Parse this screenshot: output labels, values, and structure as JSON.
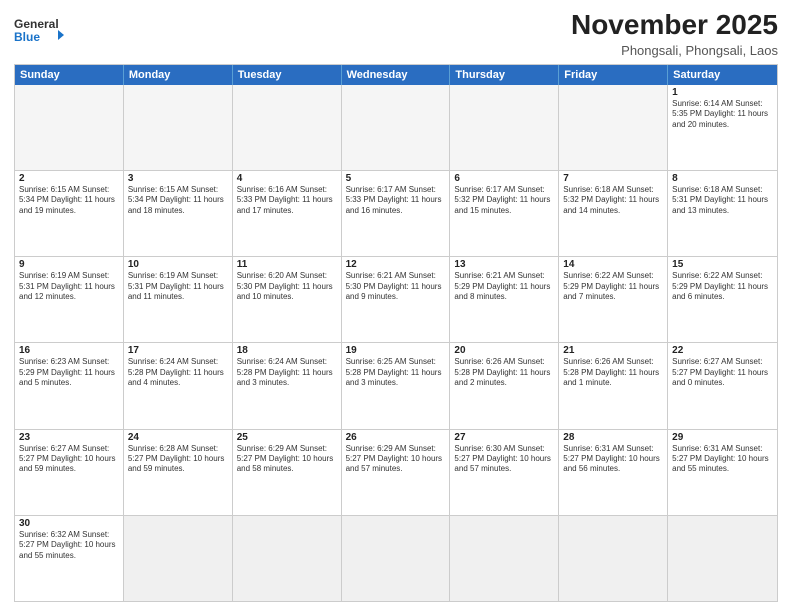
{
  "header": {
    "logo_general": "General",
    "logo_blue": "Blue",
    "month_title": "November 2025",
    "location": "Phongsali, Phongsali, Laos"
  },
  "weekdays": [
    "Sunday",
    "Monday",
    "Tuesday",
    "Wednesday",
    "Thursday",
    "Friday",
    "Saturday"
  ],
  "weeks": [
    [
      {
        "day": "",
        "info": ""
      },
      {
        "day": "",
        "info": ""
      },
      {
        "day": "",
        "info": ""
      },
      {
        "day": "",
        "info": ""
      },
      {
        "day": "",
        "info": ""
      },
      {
        "day": "",
        "info": ""
      },
      {
        "day": "1",
        "info": "Sunrise: 6:14 AM\nSunset: 5:35 PM\nDaylight: 11 hours and 20 minutes."
      }
    ],
    [
      {
        "day": "2",
        "info": "Sunrise: 6:15 AM\nSunset: 5:34 PM\nDaylight: 11 hours and 19 minutes."
      },
      {
        "day": "3",
        "info": "Sunrise: 6:15 AM\nSunset: 5:34 PM\nDaylight: 11 hours and 18 minutes."
      },
      {
        "day": "4",
        "info": "Sunrise: 6:16 AM\nSunset: 5:33 PM\nDaylight: 11 hours and 17 minutes."
      },
      {
        "day": "5",
        "info": "Sunrise: 6:17 AM\nSunset: 5:33 PM\nDaylight: 11 hours and 16 minutes."
      },
      {
        "day": "6",
        "info": "Sunrise: 6:17 AM\nSunset: 5:32 PM\nDaylight: 11 hours and 15 minutes."
      },
      {
        "day": "7",
        "info": "Sunrise: 6:18 AM\nSunset: 5:32 PM\nDaylight: 11 hours and 14 minutes."
      },
      {
        "day": "8",
        "info": "Sunrise: 6:18 AM\nSunset: 5:31 PM\nDaylight: 11 hours and 13 minutes."
      }
    ],
    [
      {
        "day": "9",
        "info": "Sunrise: 6:19 AM\nSunset: 5:31 PM\nDaylight: 11 hours and 12 minutes."
      },
      {
        "day": "10",
        "info": "Sunrise: 6:19 AM\nSunset: 5:31 PM\nDaylight: 11 hours and 11 minutes."
      },
      {
        "day": "11",
        "info": "Sunrise: 6:20 AM\nSunset: 5:30 PM\nDaylight: 11 hours and 10 minutes."
      },
      {
        "day": "12",
        "info": "Sunrise: 6:21 AM\nSunset: 5:30 PM\nDaylight: 11 hours and 9 minutes."
      },
      {
        "day": "13",
        "info": "Sunrise: 6:21 AM\nSunset: 5:29 PM\nDaylight: 11 hours and 8 minutes."
      },
      {
        "day": "14",
        "info": "Sunrise: 6:22 AM\nSunset: 5:29 PM\nDaylight: 11 hours and 7 minutes."
      },
      {
        "day": "15",
        "info": "Sunrise: 6:22 AM\nSunset: 5:29 PM\nDaylight: 11 hours and 6 minutes."
      }
    ],
    [
      {
        "day": "16",
        "info": "Sunrise: 6:23 AM\nSunset: 5:29 PM\nDaylight: 11 hours and 5 minutes."
      },
      {
        "day": "17",
        "info": "Sunrise: 6:24 AM\nSunset: 5:28 PM\nDaylight: 11 hours and 4 minutes."
      },
      {
        "day": "18",
        "info": "Sunrise: 6:24 AM\nSunset: 5:28 PM\nDaylight: 11 hours and 3 minutes."
      },
      {
        "day": "19",
        "info": "Sunrise: 6:25 AM\nSunset: 5:28 PM\nDaylight: 11 hours and 3 minutes."
      },
      {
        "day": "20",
        "info": "Sunrise: 6:26 AM\nSunset: 5:28 PM\nDaylight: 11 hours and 2 minutes."
      },
      {
        "day": "21",
        "info": "Sunrise: 6:26 AM\nSunset: 5:28 PM\nDaylight: 11 hours and 1 minute."
      },
      {
        "day": "22",
        "info": "Sunrise: 6:27 AM\nSunset: 5:27 PM\nDaylight: 11 hours and 0 minutes."
      }
    ],
    [
      {
        "day": "23",
        "info": "Sunrise: 6:27 AM\nSunset: 5:27 PM\nDaylight: 10 hours and 59 minutes."
      },
      {
        "day": "24",
        "info": "Sunrise: 6:28 AM\nSunset: 5:27 PM\nDaylight: 10 hours and 59 minutes."
      },
      {
        "day": "25",
        "info": "Sunrise: 6:29 AM\nSunset: 5:27 PM\nDaylight: 10 hours and 58 minutes."
      },
      {
        "day": "26",
        "info": "Sunrise: 6:29 AM\nSunset: 5:27 PM\nDaylight: 10 hours and 57 minutes."
      },
      {
        "day": "27",
        "info": "Sunrise: 6:30 AM\nSunset: 5:27 PM\nDaylight: 10 hours and 57 minutes."
      },
      {
        "day": "28",
        "info": "Sunrise: 6:31 AM\nSunset: 5:27 PM\nDaylight: 10 hours and 56 minutes."
      },
      {
        "day": "29",
        "info": "Sunrise: 6:31 AM\nSunset: 5:27 PM\nDaylight: 10 hours and 55 minutes."
      }
    ],
    [
      {
        "day": "30",
        "info": "Sunrise: 6:32 AM\nSunset: 5:27 PM\nDaylight: 10 hours and 55 minutes."
      },
      {
        "day": "",
        "info": ""
      },
      {
        "day": "",
        "info": ""
      },
      {
        "day": "",
        "info": ""
      },
      {
        "day": "",
        "info": ""
      },
      {
        "day": "",
        "info": ""
      },
      {
        "day": "",
        "info": ""
      }
    ]
  ]
}
